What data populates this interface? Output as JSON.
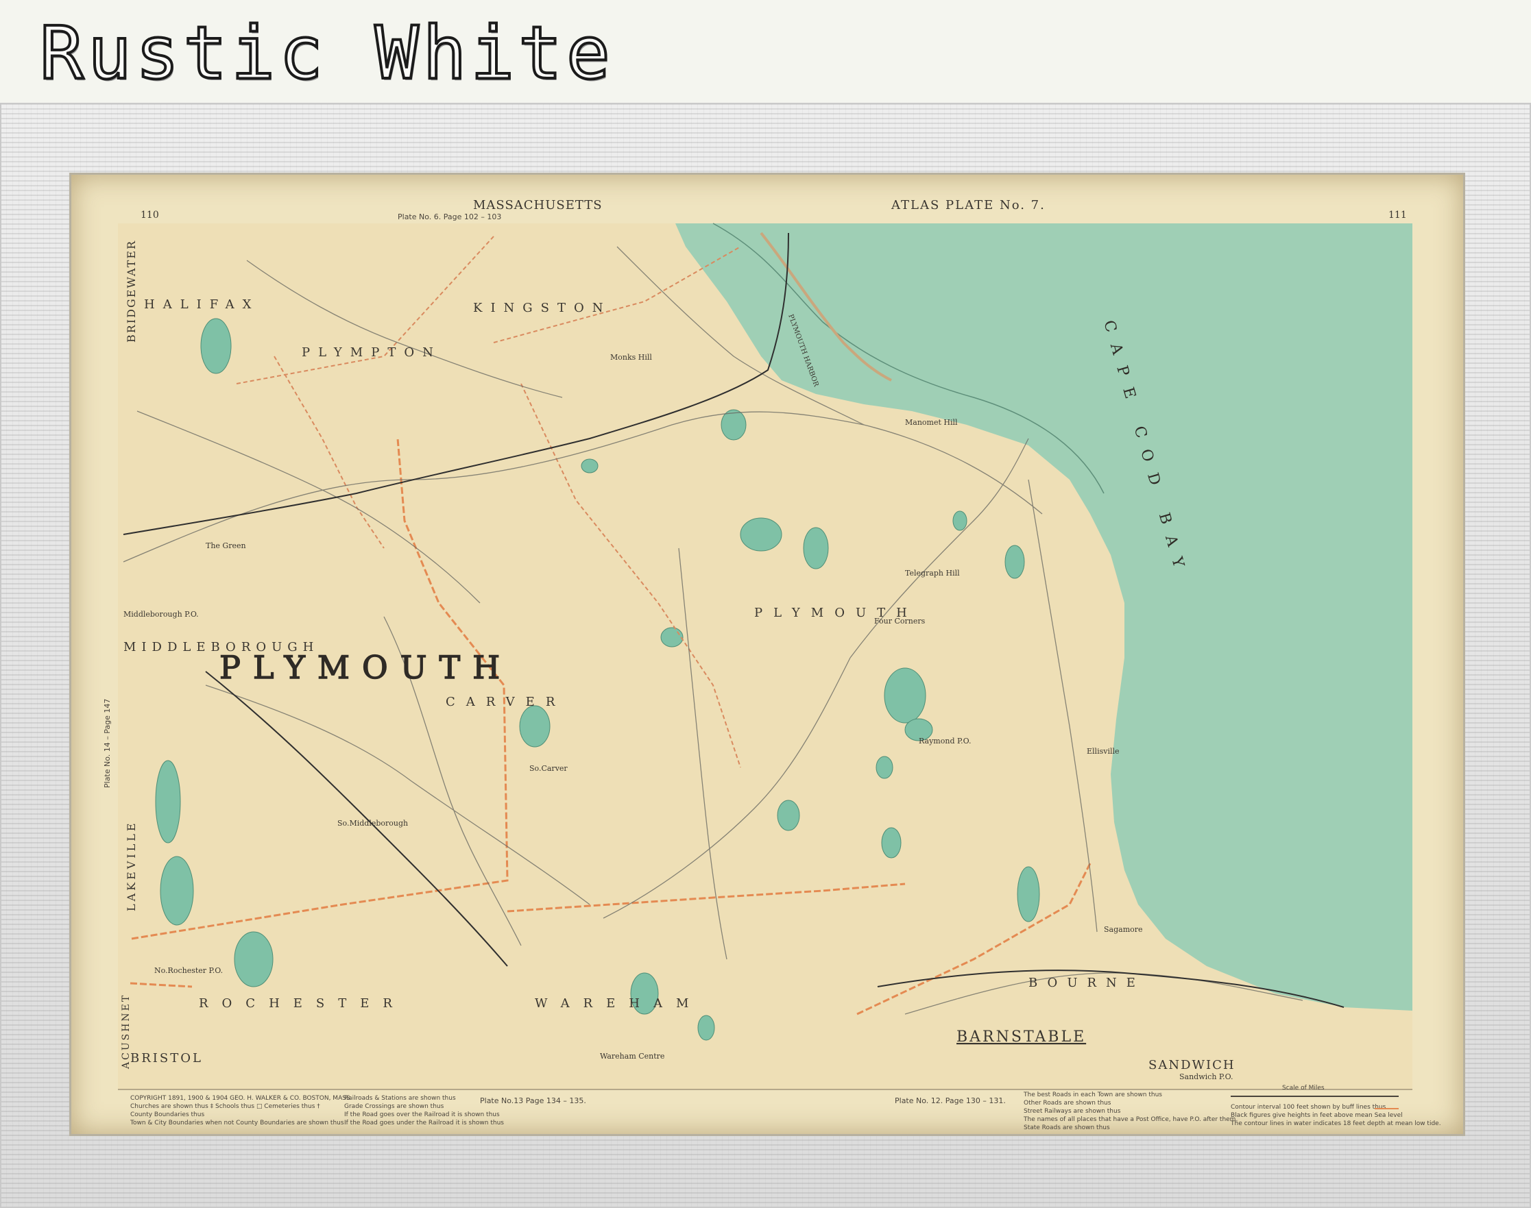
{
  "frame": {
    "title": "Rustic White",
    "style": "rustic-white-wood"
  },
  "map": {
    "header_left": "MASSACHUSETTS",
    "header_right": "ATLAS PLATE No. 7.",
    "page_left": "110",
    "page_right": "111",
    "plate_ref_top": "Plate No. 6. Page 102 – 103",
    "plate_ref_side": "Plate No. 14 – Page 147",
    "plate_ref_bottom_left": "Plate No.13 Page 134 – 135.",
    "plate_ref_bottom_right": "Plate No. 12. Page 130 – 131.",
    "bay_label": "CAPE COD BAY",
    "plymouth_county_label": "PLYMOUTH",
    "barnstable_county_label": "BARNSTABLE",
    "bristol_county_label": "BRISTOL",
    "towns": {
      "halifax": "HALIFAX",
      "kingston": "KINGSTON",
      "plympton": "PLYMPTON",
      "middleborough": "MIDDLEBOROUGH",
      "carver": "CARVER",
      "plymouth": "PLYMOUTH",
      "rochester": "ROCHESTER",
      "wareham": "WAREHAM",
      "bourne": "BOURNE",
      "sandwich": "SANDWICH",
      "bridgewater": "BRIDGEWATER",
      "lakeville": "LAKEVILLE",
      "acushnet": "ACUSHNET"
    },
    "places": {
      "manomet_hill": "Manomet Hill",
      "telegraph_hill": "Telegraph Hill",
      "four_corners": "Four Corners",
      "raymond": "Raymond P.O.",
      "ellisville": "Ellisville",
      "middleborough_po": "Middleborough P.O.",
      "so_middleborough": "So.Middleborough",
      "so_carver": "So.Carver",
      "wareham_centre": "Wareham Centre",
      "plymouth_harbor": "PLYMOUTH HARBOR",
      "monks_hill": "Monks Hill",
      "nantasket": "The Green",
      "sagamore": "Sagamore",
      "sandwich_po": "Sandwich P.O.",
      "no_rochester": "No.Rochester P.O."
    },
    "legend_left": [
      "COPYRIGHT 1891, 1900 & 1904 GEO. H. WALKER & CO. BOSTON, MASS.",
      "Churches are shown thus ‡ Schools thus □ Cemeteries thus †",
      "County Boundaries thus",
      "Town & City Boundaries when not County Boundaries are shown thus"
    ],
    "legend_mid": [
      "Railroads & Stations are shown thus",
      "Grade Crossings are shown thus",
      "If the Road goes over the Railroad it is shown thus",
      "If the Road goes under the Railroad it is shown thus"
    ],
    "legend_right": [
      "The best Roads in each Town are shown thus",
      "Other Roads are shown thus",
      "Street Railways are shown thus",
      "The names of all places that have a Post Office, have P.O. after them.",
      "State Roads are shown thus"
    ],
    "legend_far_right": [
      "Scale of Miles",
      "Contour interval 100 feet shown by buff lines thus",
      "Black figures give heights in feet above mean Sea level",
      "The contour lines in water indicates 18 feet depth at mean low tide."
    ],
    "colors": {
      "land": "#eedfb6",
      "water": "#9fcfb5",
      "county_line": "#e48a52",
      "roads": "#6b6b64",
      "ponds": "#7fc1a6"
    }
  }
}
